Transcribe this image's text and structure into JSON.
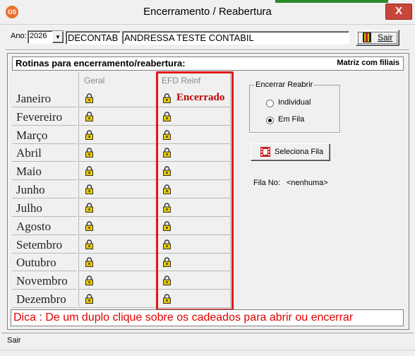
{
  "window": {
    "title": "Encerramento / Reabertura",
    "app_icon_text": "G5",
    "close_glyph": "X"
  },
  "header": {
    "ano_label": "Ano:",
    "ano_value": "2026",
    "empresa_code": "DECONTAB",
    "empresa_name": "ANDRESSA TESTE CONTABIL",
    "sair_label": "Sair"
  },
  "rotinas": {
    "title": "Rotinas para encerramento/reabertura:",
    "matriz_label": "Matriz com filiais",
    "columns": [
      "Geral",
      "EFD Reinf"
    ],
    "months": [
      {
        "name": "Janeiro",
        "status": "Encerrado"
      },
      {
        "name": "Fevereiro",
        "status": ""
      },
      {
        "name": "Março",
        "status": ""
      },
      {
        "name": "Abril",
        "status": ""
      },
      {
        "name": "Maio",
        "status": ""
      },
      {
        "name": "Junho",
        "status": ""
      },
      {
        "name": "Julho",
        "status": ""
      },
      {
        "name": "Agosto",
        "status": ""
      },
      {
        "name": "Setembro",
        "status": ""
      },
      {
        "name": "Outubro",
        "status": ""
      },
      {
        "name": "Novembro",
        "status": ""
      },
      {
        "name": "Dezembro",
        "status": ""
      }
    ]
  },
  "options": {
    "group_title": "Encerrar Reabrir",
    "radio_individual": "Individual",
    "radio_fila": "Em Fila",
    "selected": "Em Fila",
    "fila_button": "Seleciona Fila",
    "fila_no_label": "Fila No:",
    "fila_no_value": "<nenhuma>"
  },
  "dica": "Dica : De um duplo clique sobre os cadeados para  abrir ou encerrar",
  "statusbar": "Sair",
  "colors": {
    "highlight": "#e01818",
    "encerrado": "#c00000",
    "dica": "#e00000"
  }
}
